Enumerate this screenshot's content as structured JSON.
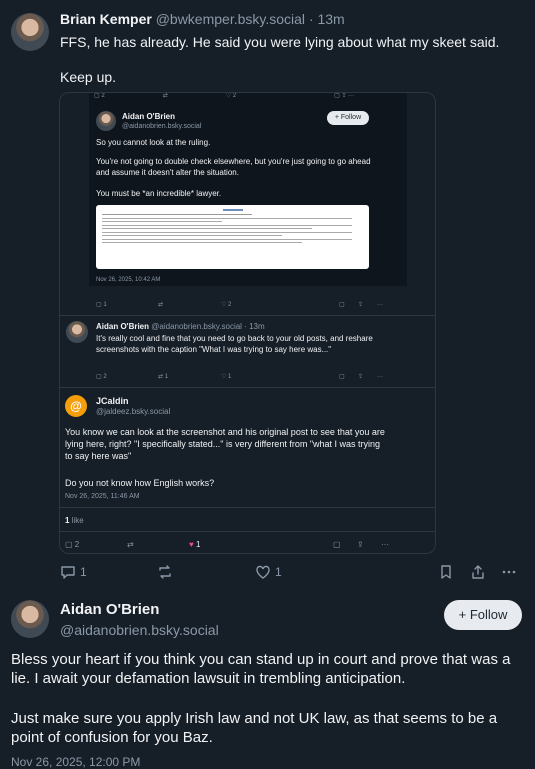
{
  "top_post": {
    "author": "Brian Kemper",
    "handle": "@bwkemper.bsky.social",
    "time": "· 13m",
    "text1": "FFS, he has already.  He said you were lying about what my skeet said.",
    "text2": "Keep up.",
    "replies": "1",
    "likes": "1"
  },
  "embedded": {
    "quoted": {
      "author": "Aidan O'Brien",
      "handle": "@aidanobrien.bsky.social",
      "follow_label": "+ Follow",
      "p1": "So you cannot look at the ruling.",
      "p2": "You're not going to double check elsewhere, but you're just going to go ahead and assume it doesn't alter the situation.",
      "p3": "You must be *an incredible* lawyer.",
      "date": "Nov 26, 2025, 10:42 AM",
      "replies": "1",
      "likes": "2",
      "top_replies": "2",
      "top_likes": "2"
    },
    "reply": {
      "author": "Aidan O'Brien",
      "handle": "@aidanobrien.bsky.social",
      "time": "· 13m",
      "text": "It's really cool and fine that you need to go back to your old posts, and reshare screenshots with the caption \"What I was trying to say here was...\"",
      "replies": "2",
      "reposts": "1",
      "likes": "1"
    },
    "jcaldin": {
      "author": "JCaldin",
      "handle": "@jaldeez.bsky.social",
      "p1": "You know we can look at the screenshot and his original post to see that you are lying here, right? \"I specifically stated...\" is very different from \"what I was trying to say here was\"",
      "p2": "Do you not know how English works?",
      "date": "Nov 26, 2025, 11:46 AM",
      "like_count": "1",
      "like_word": "like",
      "replies": "2",
      "likes": "1"
    }
  },
  "main_post": {
    "author": "Aidan O'Brien",
    "handle": "@aidanobrien.bsky.social",
    "follow_label": "+ Follow",
    "text1": "Bless your heart if you think you can stand up in court and prove that was a lie. I await your defamation lawsuit in trembling anticipation.",
    "text2": "Just make sure you apply Irish law and not UK law, as that seems to be a point of confusion for you Baz.",
    "date": "Nov 26, 2025, 12:00 PM"
  },
  "colors": {
    "bg": "#161e27",
    "muted": "#8a98a8",
    "accent": "#208bfe",
    "like": "#ec4899",
    "jc_avatar": "#f59e0b"
  }
}
